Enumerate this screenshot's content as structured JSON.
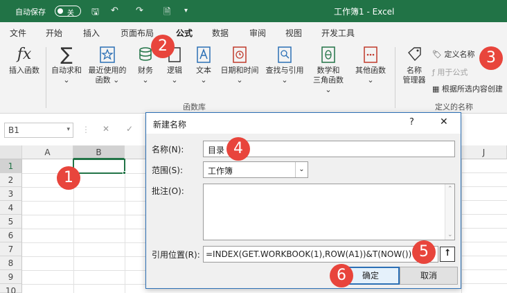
{
  "titlebar": {
    "autosave_label": "自动保存",
    "toggle_state": "关",
    "title": "工作簿1  -  Excel",
    "brand_color": "#217346"
  },
  "tabs": [
    "文件",
    "开始",
    "插入",
    "页面布局",
    "公式",
    "数据",
    "审阅",
    "视图",
    "开发工具"
  ],
  "active_tab": "公式",
  "ribbon": {
    "buttons": {
      "insert_function": "插入函数",
      "autosum": "自动求和",
      "recent_1": "最近使用的",
      "recent_2": "函数",
      "financial": "财务",
      "logical": "逻辑",
      "text": "文本",
      "datetime": "日期和时间",
      "lookup": "查找与引用",
      "math_1": "数学和",
      "math_2": "三角函数",
      "other": "其他函数",
      "name_manager_1": "名称",
      "name_manager_2": "管理器"
    },
    "fx_glyph": "fx",
    "sigma_glyph": "∑",
    "small_buttons": {
      "define_name": "定义名称",
      "use_in_formula": "用于公式",
      "create_from_selection": "根据所选内容创建"
    },
    "group_labels": {
      "function_library": "函数库",
      "defined_names": "定义的名称"
    }
  },
  "formula_bar": {
    "name_box": "B1",
    "cancel_glyph": "✕",
    "confirm_glyph": "✓"
  },
  "grid": {
    "columns": [
      "A",
      "B",
      "J"
    ],
    "rows": [
      "1",
      "2",
      "3",
      "4",
      "5",
      "6",
      "7",
      "8",
      "9",
      "10"
    ],
    "selected_cell": "B1"
  },
  "dialog": {
    "title": "新建名称",
    "help_glyph": "?",
    "close_glyph": "✕",
    "name_label": "名称(N):",
    "name_value": "目录",
    "scope_label": "范围(S):",
    "scope_value": "工作簿",
    "comment_label": "批注(O):",
    "ref_label": "引用位置(R):",
    "ref_value": "=INDEX(GET.WORKBOOK(1),ROW(A1))&T(NOW())",
    "ok_label": "确定",
    "cancel_label": "取消"
  },
  "callouts": [
    "1",
    "2",
    "3",
    "4",
    "5",
    "6"
  ],
  "callout_color": "#e8453c"
}
